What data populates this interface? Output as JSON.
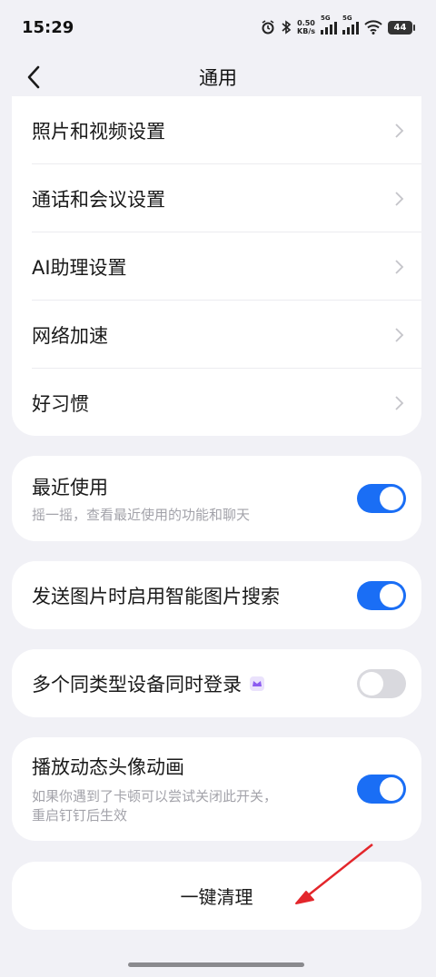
{
  "status_bar": {
    "time": "15:29",
    "net_speed_value": "0.50",
    "net_speed_unit": "KB/s",
    "sim1": "5G",
    "sim2": "5G",
    "battery": "44"
  },
  "header": {
    "title": "通用"
  },
  "settings_list": [
    {
      "label": "照片和视频设置"
    },
    {
      "label": "通话和会议设置"
    },
    {
      "label": "AI助理设置"
    },
    {
      "label": "网络加速"
    },
    {
      "label": "好习惯"
    }
  ],
  "toggles": {
    "recent": {
      "title": "最近使用",
      "desc": "摇一摇，查看最近使用的功能和聊天",
      "on": true
    },
    "image_search": {
      "title": "发送图片时启用智能图片搜索",
      "on": true
    },
    "multi_device": {
      "title": "多个同类型设备同时登录",
      "on": false
    },
    "avatar_anim": {
      "title": "播放动态头像动画",
      "desc_line1": "如果你遇到了卡顿可以尝试关闭此开关，",
      "desc_line2": "重启钉钉后生效",
      "on": true
    }
  },
  "clean_button": {
    "label": "一键清理"
  },
  "colors": {
    "accent": "#1a6ef5",
    "background": "#f1f1f6",
    "annotation_arrow": "#e3262b",
    "premium_badge": "#8c5cf0"
  }
}
